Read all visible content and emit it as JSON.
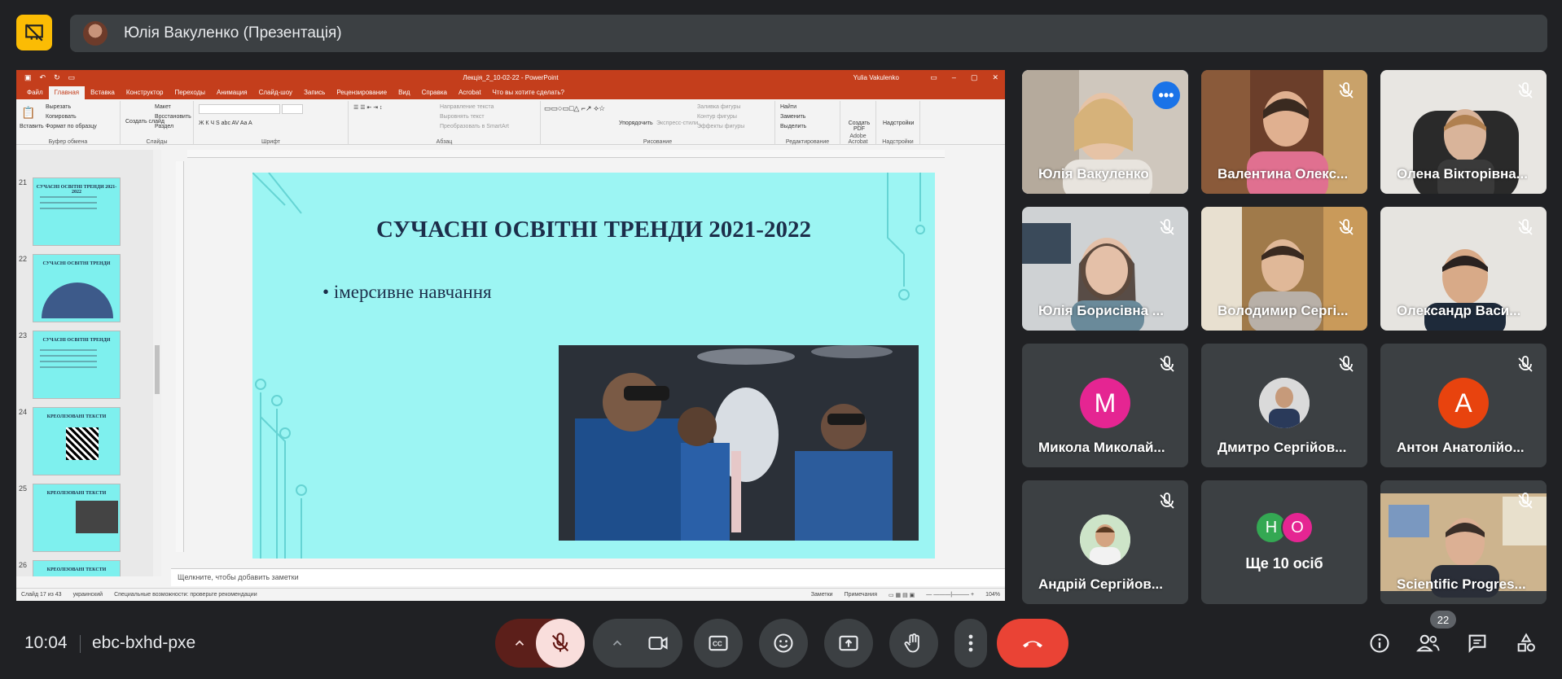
{
  "header": {
    "presenter_name": "Юлія Вакуленко (Презентація)"
  },
  "ppt": {
    "title": "Лекція_2_10-02-22 - PowerPoint",
    "user": "Yulia Vakulenko",
    "tabs": [
      "Файл",
      "Главная",
      "Вставка",
      "Конструктор",
      "Переходы",
      "Анимация",
      "Слайд-шоу",
      "Запись",
      "Рецензирование",
      "Вид",
      "Справка",
      "Acrobat",
      "Что вы хотите сделать?"
    ],
    "ribbon": {
      "paste": "Вставить",
      "cut": "Вырезать",
      "copy": "Копировать",
      "format_painter": "Формат по образцу",
      "clipboard": "Буфер обмена",
      "new_slide": "Создать слайд",
      "layout": "Макет",
      "reset": "Восстановить",
      "section": "Раздел",
      "slides": "Слайды",
      "font": "Шрифт",
      "text_direction": "Направление текста",
      "align_text": "Выровнять текст",
      "smartart": "Преобразовать в SmartArt",
      "paragraph": "Абзац",
      "arrange": "Упорядочить",
      "quick_styles": "Экспресс-стили",
      "shape_fill": "Заливка фигуры",
      "shape_outline": "Контур фигуры",
      "shape_effects": "Эффекты фигуры",
      "drawing": "Рисование",
      "find": "Найти",
      "replace": "Заменить",
      "select": "Выделить",
      "editing": "Редактирование",
      "create_pdf": "Создать PDF",
      "adobe": "Adobe Acrobat",
      "addins": "Надстройки",
      "addins_group": "Надстройки"
    },
    "thumbnails": [
      {
        "num": "21",
        "title": "СУЧАСНІ ОСВІТНІ ТРЕНДИ 2021-2022"
      },
      {
        "num": "22",
        "title": "СУЧАСНІ ОСВІТНІ ТРЕНДИ"
      },
      {
        "num": "23",
        "title": "СУЧАСНІ ОСВІТНІ ТРЕНДИ"
      },
      {
        "num": "24",
        "title": "КРЕОЛІЗОВАНІ ТЕКСТИ"
      },
      {
        "num": "25",
        "title": "КРЕОЛІЗОВАНІ ТЕКСТИ"
      },
      {
        "num": "26",
        "title": "КРЕОЛІЗОВАНІ ТЕКСТИ"
      }
    ],
    "slide": {
      "title": "СУЧАСНІ ОСВІТНІ ТРЕНДИ 2021-2022",
      "bullet": "імерсивне навчання"
    },
    "notes_placeholder": "Щелкните, чтобы добавить заметки",
    "status": {
      "slide": "Слайд 17 из 43",
      "language": "украинский",
      "accessibility": "Специальные возможности: проверьте рекомендации",
      "notes": "Заметки",
      "comments": "Примечания",
      "zoom": "104%"
    }
  },
  "participants": [
    {
      "name": "Юлія Вакуленко",
      "video": true,
      "active": true
    },
    {
      "name": "Валентина Олекс...",
      "video": true,
      "muted": true
    },
    {
      "name": "Олена Вікторівна...",
      "video": true,
      "muted": true
    },
    {
      "name": "Юлія Борисівна ...",
      "video": true,
      "muted": true
    },
    {
      "name": "Володимир Сергі...",
      "video": true,
      "muted": true
    },
    {
      "name": "Олександр Васи...",
      "video": true,
      "muted": true
    },
    {
      "name": "Микола Миколай...",
      "initial": "М",
      "color": "#e52592",
      "muted": true
    },
    {
      "name": "Дмитро Сергійов...",
      "photo": true,
      "muted": true
    },
    {
      "name": "Антон Анатолійо...",
      "initial": "А",
      "color": "#e8430e",
      "muted": true
    },
    {
      "name": "Андрій Сергійов...",
      "photo": true,
      "muted": true
    },
    {
      "name": "Ще 10 осіб",
      "more": true
    },
    {
      "name": "Scientific Progres...",
      "video": true,
      "muted": true
    }
  ],
  "more_initials": [
    "Н",
    "О"
  ],
  "colors": {
    "accent": "#8ab4f8",
    "end_call": "#ea4335",
    "present": "#fbbc04",
    "mic_off_bg": "#f9dedc"
  },
  "bottom": {
    "time": "10:04",
    "meeting_code": "ebc-bxhd-pxe",
    "participant_count": "22"
  }
}
